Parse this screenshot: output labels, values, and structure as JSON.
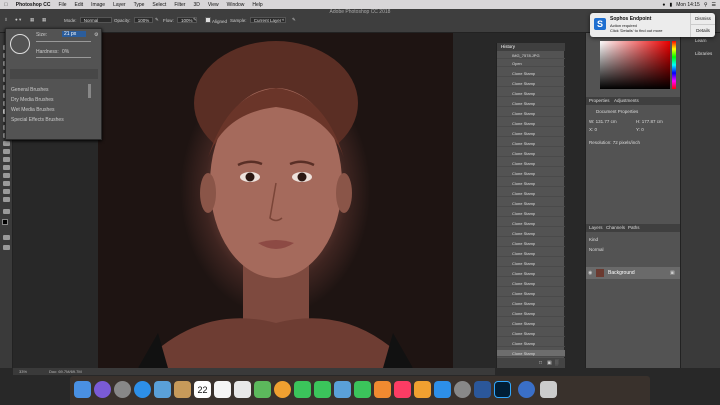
{
  "menubar": {
    "app": "Photoshop CC",
    "items": [
      "File",
      "Edit",
      "Image",
      "Layer",
      "Type",
      "Select",
      "Filter",
      "3D",
      "View",
      "Window",
      "Help"
    ],
    "clock": "Mon 14:15"
  },
  "window_title": "Adobe Photoshop CC 2018",
  "options": {
    "mode_label": "Mode:",
    "mode": "Normal",
    "opacity_label": "Opacity:",
    "opacity": "100%",
    "flow_label": "Flow:",
    "flow": "100%",
    "aligned": "Aligned",
    "sample_label": "Sample:",
    "sample": "Current Layer"
  },
  "brush": {
    "size_label": "Size:",
    "size": "21 px",
    "hardness_label": "Hardness:",
    "hardness": "0%",
    "folders": [
      "General Brushes",
      "Dry Media Brushes",
      "Wet Media Brushes",
      "Special Effects Brushes"
    ]
  },
  "history": {
    "title": "History",
    "snapshot": "IMG_7578.JPG",
    "open": "Open",
    "step": "Clone Stamp",
    "count": 29
  },
  "properties": {
    "tabs": [
      "Properties",
      "Adjustments"
    ],
    "doc": "Document Properties",
    "w": "W: 131.77 cm",
    "h": "H: 177.87 cm",
    "x": "X: 0",
    "y": "Y: 0",
    "resolution": "Resolution: 72 pixels/inch"
  },
  "layers": {
    "tabs": [
      "Layers",
      "Channels",
      "Paths"
    ],
    "kind": "Kind",
    "mode": "Normal",
    "layer_name": "Background"
  },
  "farright": {
    "learn": "Learn",
    "libraries": "Libraries"
  },
  "notification": {
    "title": "Sophos Endpoint",
    "line1": "Action required",
    "line2": "Click 'Details' to find out more",
    "dismiss": "Dismiss",
    "details": "Details"
  },
  "status": {
    "zoom": "33%",
    "doc": "Doc: 69.7M/69.7M"
  },
  "dock": {
    "calendar_day": "22"
  }
}
